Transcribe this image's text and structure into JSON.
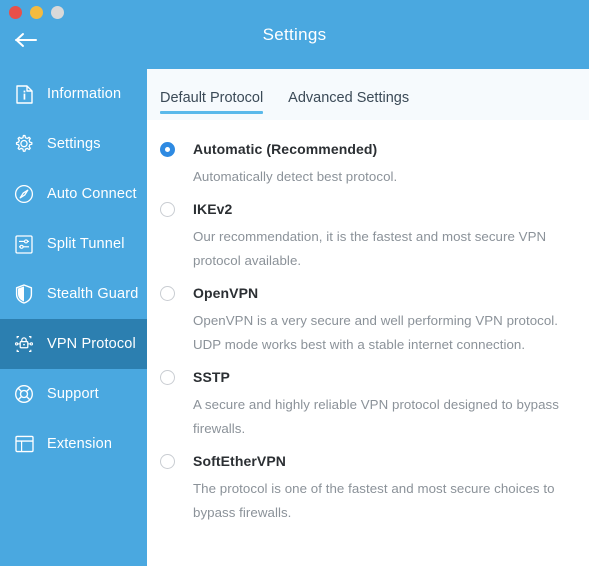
{
  "window": {
    "lights": [
      {
        "name": "close",
        "color": "#e8504a"
      },
      {
        "name": "minimize",
        "color": "#f4bb40"
      },
      {
        "name": "zoom",
        "color": "#d9d9d9"
      }
    ],
    "title": "Settings",
    "back_label": "Back"
  },
  "theme": {
    "brand_blue": "#4aa8e0",
    "active_nav_blue": "#2c7fb0",
    "accent_blue": "#2e8ae2",
    "tab_underline": "#5bb9ea",
    "tabbar_bg": "#f6fafd",
    "title_text": "#2b2f33",
    "desc_text": "#8b9299"
  },
  "sidebar": {
    "items": [
      {
        "label": "Information",
        "icon": "information-icon",
        "active": false
      },
      {
        "label": "Settings",
        "icon": "gear-icon",
        "active": false
      },
      {
        "label": "Auto Connect",
        "icon": "auto-connect-icon",
        "active": false
      },
      {
        "label": "Split Tunnel",
        "icon": "split-tunnel-icon",
        "active": false
      },
      {
        "label": "Stealth Guard",
        "icon": "shield-icon",
        "active": false
      },
      {
        "label": "VPN Protocol",
        "icon": "vpn-protocol-icon",
        "active": true
      },
      {
        "label": "Support",
        "icon": "lifebuoy-icon",
        "active": false
      },
      {
        "label": "Extension",
        "icon": "extension-icon",
        "active": false
      }
    ]
  },
  "main": {
    "tabs": [
      {
        "label": "Default Protocol",
        "active": true
      },
      {
        "label": "Advanced Settings",
        "active": false
      }
    ],
    "protocols": [
      {
        "title": "Automatic (Recommended)",
        "description": "Automatically detect best protocol.",
        "selected": true
      },
      {
        "title": "IKEv2",
        "description": "Our recommendation, it is the fastest and most secure VPN protocol available.",
        "selected": false
      },
      {
        "title": "OpenVPN",
        "description": "OpenVPN is a very secure and well performing VPN protocol. UDP mode works best with a stable internet connection.",
        "selected": false
      },
      {
        "title": "SSTP",
        "description": "A secure and highly reliable VPN protocol designed to bypass firewalls.",
        "selected": false
      },
      {
        "title": "SoftEtherVPN",
        "description": "The protocol is one of the fastest and most secure choices to bypass firewalls.",
        "selected": false
      }
    ]
  }
}
